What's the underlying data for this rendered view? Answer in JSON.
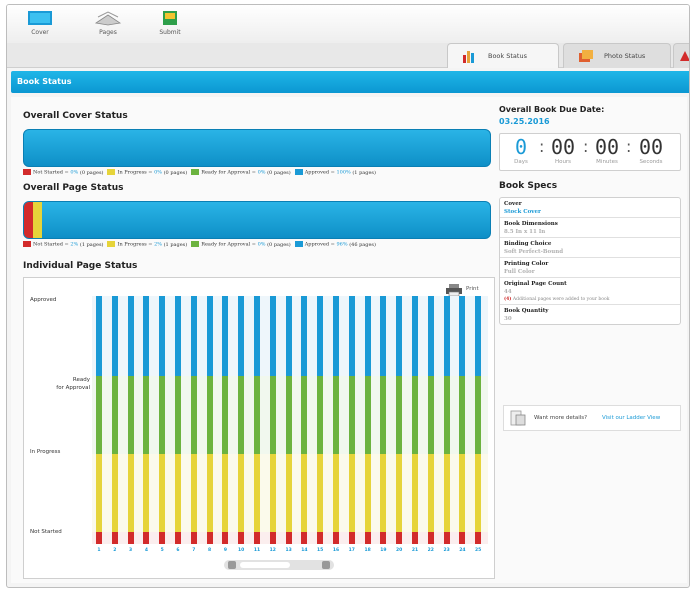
{
  "nav": {
    "items": [
      {
        "label": "Cover",
        "icon": "book-cover-icon"
      },
      {
        "label": "Pages",
        "icon": "open-book-icon"
      },
      {
        "label": "Submit",
        "icon": "submit-book-icon"
      }
    ]
  },
  "tabs": [
    {
      "label": "Book Status",
      "icon": "bar-chart-icon",
      "active": true
    },
    {
      "label": "Photo Status",
      "icon": "photo-stack-icon",
      "active": false
    }
  ],
  "page_title": "Book Status",
  "cover_status": {
    "title": "Overall Cover Status",
    "legend": [
      {
        "label": "Not Started",
        "pct": "0%",
        "pages": "(0 pages)",
        "color": "#d22b2b"
      },
      {
        "label": "In Progress",
        "pct": "0%",
        "pages": "(0 pages)",
        "color": "#e6d43a"
      },
      {
        "label": "Ready for Approval",
        "pct": "0%",
        "pages": "(0 pages)",
        "color": "#6cb33f"
      },
      {
        "label": "Approved",
        "pct": "100%",
        "pages": "(1 pages)",
        "color": "#1a9ad6"
      }
    ]
  },
  "page_status": {
    "title": "Overall Page Status",
    "legend": [
      {
        "label": "Not Started",
        "pct": "2%",
        "pages": "(1 pages)",
        "color": "#d22b2b"
      },
      {
        "label": "In Progress",
        "pct": "2%",
        "pages": "(1 pages)",
        "color": "#e6d43a"
      },
      {
        "label": "Ready for Approval",
        "pct": "0%",
        "pages": "(0 pages)",
        "color": "#6cb33f"
      },
      {
        "label": "Approved",
        "pct": "96%",
        "pages": "(46 pages)",
        "color": "#1a9ad6"
      }
    ]
  },
  "individual": {
    "title": "Individual Page Status",
    "print_label": "Print",
    "y_labels": [
      "Approved",
      "Ready\nfor Approval",
      "In Progress",
      "Not Started"
    ],
    "pages": [
      "1",
      "2",
      "3",
      "4",
      "5",
      "6",
      "7",
      "8",
      "9",
      "10",
      "11",
      "12",
      "13",
      "14",
      "15",
      "16",
      "17",
      "18",
      "19",
      "20",
      "21",
      "22",
      "23",
      "24",
      "25"
    ]
  },
  "due_date": {
    "label": "Overall Book Due Date:",
    "value": "03.25.2016",
    "timer": [
      {
        "value": "0",
        "label": "Days"
      },
      {
        "value": "00",
        "label": "Hours"
      },
      {
        "value": "00",
        "label": "Minutes"
      },
      {
        "value": "00",
        "label": "Seconds"
      }
    ],
    "separator": ":"
  },
  "specs": {
    "title": "Book Specs",
    "cover_h": "Cover",
    "cover_v": "Stock Cover",
    "dims_h": "Book Dimensions",
    "dims_v": "8.5 In x 11 In",
    "binding_h": "Binding Choice",
    "binding_v": "Soft Perfect-Bound",
    "printing_h": "Printing Color",
    "printing_v": "Full Color",
    "orig_h": "Original Page Count",
    "orig_v": "44",
    "orig_note_num": "(4)",
    "orig_note_txt": "Additional pages were added to your book",
    "qty_h": "Book Quantity",
    "qty_v": "30"
  },
  "ladder": {
    "text": "Want more details?",
    "link": "Visit our Ladder View"
  },
  "colors": {
    "accent": "#1a9ad6",
    "red": "#d22b2b",
    "yellow": "#e6d43a",
    "green": "#6cb33f",
    "blue": "#1a9ad6"
  }
}
